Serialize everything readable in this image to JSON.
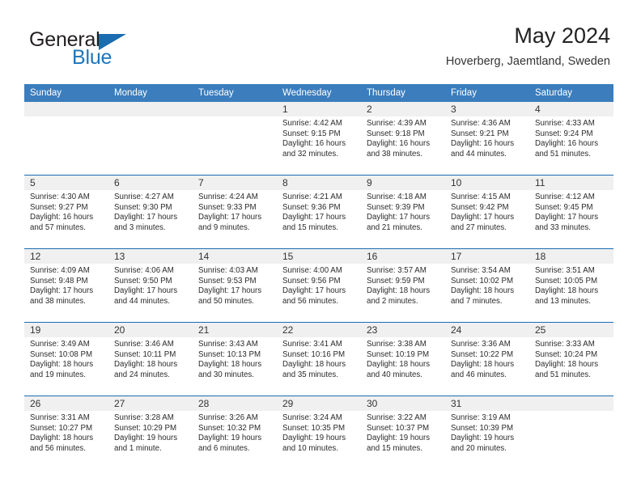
{
  "brand": {
    "name_part1": "General",
    "name_part2": "Blue",
    "flag_icon": "triangle-flag-icon"
  },
  "header": {
    "month_title": "May 2024",
    "location": "Hoverberg, Jaemtland, Sweden",
    "accent_color": "#1b6cb0",
    "header_bar_color": "#3b7dbd",
    "daynum_band_color": "#f0f0f0"
  },
  "weekday_headers": [
    "Sunday",
    "Monday",
    "Tuesday",
    "Wednesday",
    "Thursday",
    "Friday",
    "Saturday"
  ],
  "weeks": [
    [
      {
        "day": "",
        "sunrise": "",
        "sunset": "",
        "daylight_line1": "",
        "daylight_line2": ""
      },
      {
        "day": "",
        "sunrise": "",
        "sunset": "",
        "daylight_line1": "",
        "daylight_line2": ""
      },
      {
        "day": "",
        "sunrise": "",
        "sunset": "",
        "daylight_line1": "",
        "daylight_line2": ""
      },
      {
        "day": "1",
        "sunrise": "Sunrise: 4:42 AM",
        "sunset": "Sunset: 9:15 PM",
        "daylight_line1": "Daylight: 16 hours",
        "daylight_line2": "and 32 minutes."
      },
      {
        "day": "2",
        "sunrise": "Sunrise: 4:39 AM",
        "sunset": "Sunset: 9:18 PM",
        "daylight_line1": "Daylight: 16 hours",
        "daylight_line2": "and 38 minutes."
      },
      {
        "day": "3",
        "sunrise": "Sunrise: 4:36 AM",
        "sunset": "Sunset: 9:21 PM",
        "daylight_line1": "Daylight: 16 hours",
        "daylight_line2": "and 44 minutes."
      },
      {
        "day": "4",
        "sunrise": "Sunrise: 4:33 AM",
        "sunset": "Sunset: 9:24 PM",
        "daylight_line1": "Daylight: 16 hours",
        "daylight_line2": "and 51 minutes."
      }
    ],
    [
      {
        "day": "5",
        "sunrise": "Sunrise: 4:30 AM",
        "sunset": "Sunset: 9:27 PM",
        "daylight_line1": "Daylight: 16 hours",
        "daylight_line2": "and 57 minutes."
      },
      {
        "day": "6",
        "sunrise": "Sunrise: 4:27 AM",
        "sunset": "Sunset: 9:30 PM",
        "daylight_line1": "Daylight: 17 hours",
        "daylight_line2": "and 3 minutes."
      },
      {
        "day": "7",
        "sunrise": "Sunrise: 4:24 AM",
        "sunset": "Sunset: 9:33 PM",
        "daylight_line1": "Daylight: 17 hours",
        "daylight_line2": "and 9 minutes."
      },
      {
        "day": "8",
        "sunrise": "Sunrise: 4:21 AM",
        "sunset": "Sunset: 9:36 PM",
        "daylight_line1": "Daylight: 17 hours",
        "daylight_line2": "and 15 minutes."
      },
      {
        "day": "9",
        "sunrise": "Sunrise: 4:18 AM",
        "sunset": "Sunset: 9:39 PM",
        "daylight_line1": "Daylight: 17 hours",
        "daylight_line2": "and 21 minutes."
      },
      {
        "day": "10",
        "sunrise": "Sunrise: 4:15 AM",
        "sunset": "Sunset: 9:42 PM",
        "daylight_line1": "Daylight: 17 hours",
        "daylight_line2": "and 27 minutes."
      },
      {
        "day": "11",
        "sunrise": "Sunrise: 4:12 AM",
        "sunset": "Sunset: 9:45 PM",
        "daylight_line1": "Daylight: 17 hours",
        "daylight_line2": "and 33 minutes."
      }
    ],
    [
      {
        "day": "12",
        "sunrise": "Sunrise: 4:09 AM",
        "sunset": "Sunset: 9:48 PM",
        "daylight_line1": "Daylight: 17 hours",
        "daylight_line2": "and 38 minutes."
      },
      {
        "day": "13",
        "sunrise": "Sunrise: 4:06 AM",
        "sunset": "Sunset: 9:50 PM",
        "daylight_line1": "Daylight: 17 hours",
        "daylight_line2": "and 44 minutes."
      },
      {
        "day": "14",
        "sunrise": "Sunrise: 4:03 AM",
        "sunset": "Sunset: 9:53 PM",
        "daylight_line1": "Daylight: 17 hours",
        "daylight_line2": "and 50 minutes."
      },
      {
        "day": "15",
        "sunrise": "Sunrise: 4:00 AM",
        "sunset": "Sunset: 9:56 PM",
        "daylight_line1": "Daylight: 17 hours",
        "daylight_line2": "and 56 minutes."
      },
      {
        "day": "16",
        "sunrise": "Sunrise: 3:57 AM",
        "sunset": "Sunset: 9:59 PM",
        "daylight_line1": "Daylight: 18 hours",
        "daylight_line2": "and 2 minutes."
      },
      {
        "day": "17",
        "sunrise": "Sunrise: 3:54 AM",
        "sunset": "Sunset: 10:02 PM",
        "daylight_line1": "Daylight: 18 hours",
        "daylight_line2": "and 7 minutes."
      },
      {
        "day": "18",
        "sunrise": "Sunrise: 3:51 AM",
        "sunset": "Sunset: 10:05 PM",
        "daylight_line1": "Daylight: 18 hours",
        "daylight_line2": "and 13 minutes."
      }
    ],
    [
      {
        "day": "19",
        "sunrise": "Sunrise: 3:49 AM",
        "sunset": "Sunset: 10:08 PM",
        "daylight_line1": "Daylight: 18 hours",
        "daylight_line2": "and 19 minutes."
      },
      {
        "day": "20",
        "sunrise": "Sunrise: 3:46 AM",
        "sunset": "Sunset: 10:11 PM",
        "daylight_line1": "Daylight: 18 hours",
        "daylight_line2": "and 24 minutes."
      },
      {
        "day": "21",
        "sunrise": "Sunrise: 3:43 AM",
        "sunset": "Sunset: 10:13 PM",
        "daylight_line1": "Daylight: 18 hours",
        "daylight_line2": "and 30 minutes."
      },
      {
        "day": "22",
        "sunrise": "Sunrise: 3:41 AM",
        "sunset": "Sunset: 10:16 PM",
        "daylight_line1": "Daylight: 18 hours",
        "daylight_line2": "and 35 minutes."
      },
      {
        "day": "23",
        "sunrise": "Sunrise: 3:38 AM",
        "sunset": "Sunset: 10:19 PM",
        "daylight_line1": "Daylight: 18 hours",
        "daylight_line2": "and 40 minutes."
      },
      {
        "day": "24",
        "sunrise": "Sunrise: 3:36 AM",
        "sunset": "Sunset: 10:22 PM",
        "daylight_line1": "Daylight: 18 hours",
        "daylight_line2": "and 46 minutes."
      },
      {
        "day": "25",
        "sunrise": "Sunrise: 3:33 AM",
        "sunset": "Sunset: 10:24 PM",
        "daylight_line1": "Daylight: 18 hours",
        "daylight_line2": "and 51 minutes."
      }
    ],
    [
      {
        "day": "26",
        "sunrise": "Sunrise: 3:31 AM",
        "sunset": "Sunset: 10:27 PM",
        "daylight_line1": "Daylight: 18 hours",
        "daylight_line2": "and 56 minutes."
      },
      {
        "day": "27",
        "sunrise": "Sunrise: 3:28 AM",
        "sunset": "Sunset: 10:29 PM",
        "daylight_line1": "Daylight: 19 hours",
        "daylight_line2": "and 1 minute."
      },
      {
        "day": "28",
        "sunrise": "Sunrise: 3:26 AM",
        "sunset": "Sunset: 10:32 PM",
        "daylight_line1": "Daylight: 19 hours",
        "daylight_line2": "and 6 minutes."
      },
      {
        "day": "29",
        "sunrise": "Sunrise: 3:24 AM",
        "sunset": "Sunset: 10:35 PM",
        "daylight_line1": "Daylight: 19 hours",
        "daylight_line2": "and 10 minutes."
      },
      {
        "day": "30",
        "sunrise": "Sunrise: 3:22 AM",
        "sunset": "Sunset: 10:37 PM",
        "daylight_line1": "Daylight: 19 hours",
        "daylight_line2": "and 15 minutes."
      },
      {
        "day": "31",
        "sunrise": "Sunrise: 3:19 AM",
        "sunset": "Sunset: 10:39 PM",
        "daylight_line1": "Daylight: 19 hours",
        "daylight_line2": "and 20 minutes."
      },
      {
        "day": "",
        "sunrise": "",
        "sunset": "",
        "daylight_line1": "",
        "daylight_line2": ""
      }
    ]
  ]
}
